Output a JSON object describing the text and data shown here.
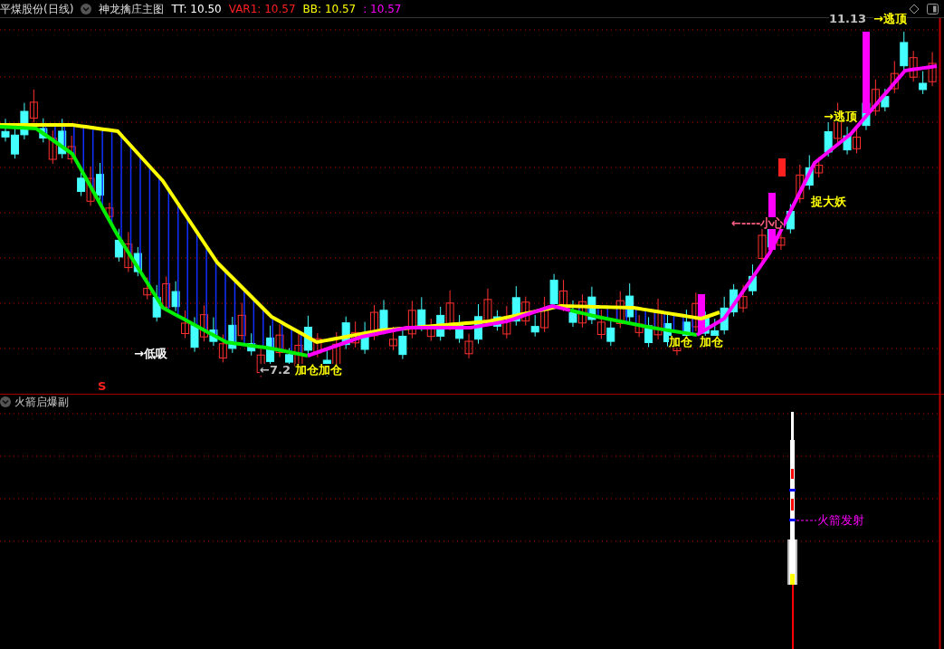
{
  "header": {
    "stock": "平煤股份(日线)",
    "indicator": "神龙擒庄主图",
    "values": [
      {
        "text": "TT: 10.50",
        "color": "#ffffff"
      },
      {
        "text": "VAR1: 10.57",
        "color": "#ff2020"
      },
      {
        "text": "BB: 10.57",
        "color": "#ffff00"
      },
      {
        "text": ": 10.57",
        "color": "#ff00ff"
      }
    ]
  },
  "main_chart": {
    "annotations": [
      {
        "text": "→低吸",
        "color": "#ffffff"
      },
      {
        "text": "S",
        "color": "#ff2020"
      },
      {
        "text": "←7.2",
        "color": "#c0c0c0"
      },
      {
        "text": "加仓加仓",
        "color": "#ffff00"
      },
      {
        "text": "加仓",
        "color": "#ffff00"
      },
      {
        "text": "加仓",
        "color": "#ffff00"
      },
      {
        "text": "←----小心",
        "color": "#ff6080"
      },
      {
        "text": "捉大妖",
        "color": "#ffff00"
      },
      {
        "text": "→逃顶",
        "color": "#ffff00"
      },
      {
        "text": "11.13",
        "color": "#c0c0c0"
      },
      {
        "text": "→逃顶",
        "color": "#ffff00"
      }
    ]
  },
  "sub_panel": {
    "title": "火箭启爆副",
    "label": "火箭发射"
  }
}
